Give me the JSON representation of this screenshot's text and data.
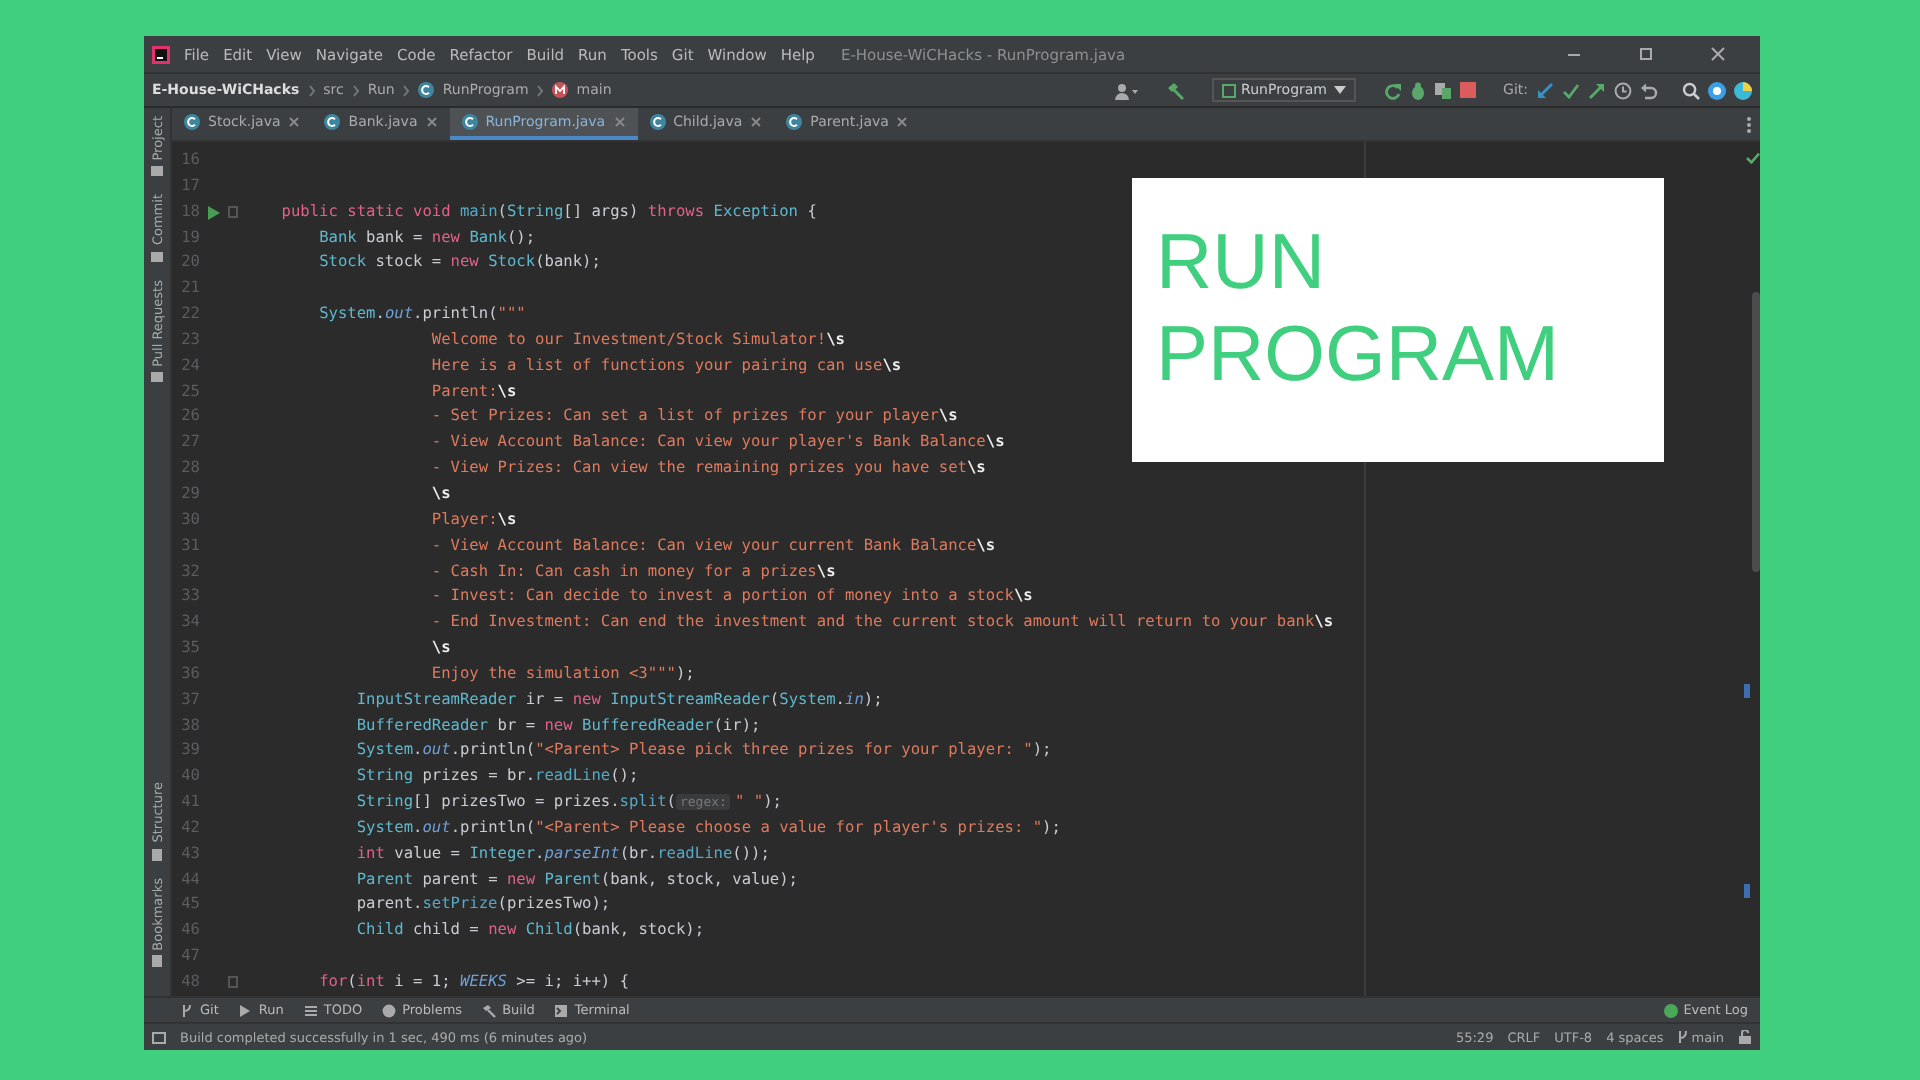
{
  "window": {
    "title": "E-House-WiCHacks - RunProgram.java",
    "menu": [
      "File",
      "Edit",
      "View",
      "Navigate",
      "Code",
      "Refactor",
      "Build",
      "Run",
      "Tools",
      "Git",
      "Window",
      "Help"
    ]
  },
  "breadcrumb": [
    {
      "label": "E-House-WiCHacks",
      "kind": "project"
    },
    {
      "label": "src",
      "kind": "folder"
    },
    {
      "label": "Run",
      "kind": "folder"
    },
    {
      "label": "RunProgram",
      "kind": "class"
    },
    {
      "label": "main",
      "kind": "method"
    }
  ],
  "toolbar": {
    "run_configuration": "RunProgram",
    "vcs_label": "Git:"
  },
  "side_tools": [
    {
      "label": "Project",
      "kind": "top"
    },
    {
      "label": "Commit",
      "kind": "top"
    },
    {
      "label": "Pull Requests",
      "kind": "top"
    },
    {
      "label": "Structure",
      "kind": "bottom"
    },
    {
      "label": "Bookmarks",
      "kind": "bottom"
    }
  ],
  "tabs": [
    {
      "label": "Stock.java",
      "selected": false
    },
    {
      "label": "Bank.java",
      "selected": false
    },
    {
      "label": "RunProgram.java",
      "selected": true
    },
    {
      "label": "Child.java",
      "selected": false
    },
    {
      "label": "Parent.java",
      "selected": false
    }
  ],
  "editor": {
    "lines": [
      {
        "n": "16",
        "run": false,
        "fold": false
      },
      {
        "n": "17",
        "run": false,
        "fold": false
      },
      {
        "n": "18",
        "run": true,
        "fold": true,
        "kind": "member",
        "tokens": [
          {
            "kind": "kw",
            "text": "public static void "
          },
          {
            "kind": "fn",
            "text": "main"
          },
          {
            "kind": "plain",
            "text": "("
          },
          {
            "kind": "type",
            "text": "String"
          },
          {
            "kind": "plain",
            "text": "[] args) "
          },
          {
            "kind": "kw",
            "text": "throws "
          },
          {
            "kind": "type",
            "text": "Exception"
          },
          {
            "kind": "plain",
            "text": " {"
          }
        ]
      },
      {
        "n": "19",
        "run": false,
        "fold": false,
        "kind": "method",
        "tokens": [
          {
            "kind": "type",
            "text": "Bank"
          },
          {
            "kind": "plain",
            "text": " bank = "
          },
          {
            "kind": "kw",
            "text": "new "
          },
          {
            "kind": "type",
            "text": "Bank"
          },
          {
            "kind": "plain",
            "text": "();"
          }
        ]
      },
      {
        "n": "20",
        "run": false,
        "fold": false,
        "kind": "method",
        "tokens": [
          {
            "kind": "type",
            "text": "Stock"
          },
          {
            "kind": "plain",
            "text": " stock = "
          },
          {
            "kind": "kw",
            "text": "new "
          },
          {
            "kind": "type",
            "text": "Stock"
          },
          {
            "kind": "plain",
            "text": "(bank);"
          }
        ]
      },
      {
        "n": "21",
        "run": false,
        "fold": false
      },
      {
        "n": "22",
        "run": false,
        "fold": false,
        "kind": "method",
        "tokens": [
          {
            "kind": "type",
            "text": "System"
          },
          {
            "kind": "plain",
            "text": "."
          },
          {
            "kind": "field",
            "text": "out"
          },
          {
            "kind": "plain",
            "text": ".println("
          },
          {
            "kind": "str",
            "text": "\"\"\""
          }
        ]
      },
      {
        "n": "23",
        "run": false,
        "fold": false,
        "kind": "text",
        "tokens": [
          {
            "kind": "str",
            "text": "Welcome to our Investment/Stock Simulator!"
          },
          {
            "kind": "esc",
            "text": "\\s"
          }
        ]
      },
      {
        "n": "24",
        "run": false,
        "fold": false,
        "kind": "text",
        "tokens": [
          {
            "kind": "str",
            "text": "Here is a list of functions your pairing can use"
          },
          {
            "kind": "esc",
            "text": "\\s"
          }
        ]
      },
      {
        "n": "25",
        "run": false,
        "fold": false,
        "kind": "text",
        "tokens": [
          {
            "kind": "str",
            "text": "Parent:"
          },
          {
            "kind": "esc",
            "text": "\\s"
          }
        ]
      },
      {
        "n": "26",
        "run": false,
        "fold": false,
        "kind": "text",
        "tokens": [
          {
            "kind": "str",
            "text": "- Set Prizes: Can set a list of prizes for your player"
          },
          {
            "kind": "esc",
            "text": "\\s"
          }
        ]
      },
      {
        "n": "27",
        "run": false,
        "fold": false,
        "kind": "text",
        "tokens": [
          {
            "kind": "str",
            "text": "- View Account Balance: Can view your player's Bank Balance"
          },
          {
            "kind": "esc",
            "text": "\\s"
          }
        ]
      },
      {
        "n": "28",
        "run": false,
        "fold": false,
        "kind": "text",
        "tokens": [
          {
            "kind": "str",
            "text": "- View Prizes: Can view the remaining prizes you have set"
          },
          {
            "kind": "esc",
            "text": "\\s"
          }
        ]
      },
      {
        "n": "29",
        "run": false,
        "fold": false,
        "kind": "text",
        "tokens": [
          {
            "kind": "esc",
            "text": "\\s"
          }
        ]
      },
      {
        "n": "30",
        "run": false,
        "fold": false,
        "kind": "text",
        "tokens": [
          {
            "kind": "str",
            "text": "Player:"
          },
          {
            "kind": "esc",
            "text": "\\s"
          }
        ]
      },
      {
        "n": "31",
        "run": false,
        "fold": false,
        "kind": "text",
        "tokens": [
          {
            "kind": "str",
            "text": "- View Account Balance: Can view your current Bank Balance"
          },
          {
            "kind": "esc",
            "text": "\\s"
          }
        ]
      },
      {
        "n": "32",
        "run": false,
        "fold": false,
        "kind": "text",
        "tokens": [
          {
            "kind": "str",
            "text": "- Cash In: Can cash in money for a prizes"
          },
          {
            "kind": "esc",
            "text": "\\s"
          }
        ]
      },
      {
        "n": "33",
        "run": false,
        "fold": false,
        "kind": "text",
        "tokens": [
          {
            "kind": "str",
            "text": "- Invest: Can decide to invest a portion of money into a stock"
          },
          {
            "kind": "esc",
            "text": "\\s"
          }
        ]
      },
      {
        "n": "34",
        "run": false,
        "fold": false,
        "kind": "text",
        "tokens": [
          {
            "kind": "str",
            "text": "- End Investment: Can end the investment and the current stock amount will return to your bank"
          },
          {
            "kind": "esc",
            "text": "\\s"
          }
        ]
      },
      {
        "n": "35",
        "run": false,
        "fold": false,
        "kind": "text",
        "tokens": [
          {
            "kind": "esc",
            "text": "\\s"
          }
        ]
      },
      {
        "n": "36",
        "run": false,
        "fold": false,
        "kind": "text",
        "tokens": [
          {
            "kind": "str",
            "text": "Enjoy the simulation <3\"\"\""
          },
          {
            "kind": "plain",
            "text": ");"
          }
        ]
      },
      {
        "n": "37",
        "run": false,
        "fold": false,
        "kind": "nested",
        "tokens": [
          {
            "kind": "type",
            "text": "InputStreamReader"
          },
          {
            "kind": "plain",
            "text": " ir = "
          },
          {
            "kind": "kw",
            "text": "new "
          },
          {
            "kind": "type",
            "text": "InputStreamReader"
          },
          {
            "kind": "plain",
            "text": "("
          },
          {
            "kind": "type",
            "text": "System"
          },
          {
            "kind": "plain",
            "text": "."
          },
          {
            "kind": "field",
            "text": "in"
          },
          {
            "kind": "plain",
            "text": ");"
          }
        ]
      },
      {
        "n": "38",
        "run": false,
        "fold": false,
        "kind": "nested",
        "tokens": [
          {
            "kind": "type",
            "text": "BufferedReader"
          },
          {
            "kind": "plain",
            "text": " br = "
          },
          {
            "kind": "kw",
            "text": "new "
          },
          {
            "kind": "type",
            "text": "BufferedReader"
          },
          {
            "kind": "plain",
            "text": "(ir);"
          }
        ]
      },
      {
        "n": "39",
        "run": false,
        "fold": false,
        "kind": "nested",
        "tokens": [
          {
            "kind": "type",
            "text": "System"
          },
          {
            "kind": "plain",
            "text": "."
          },
          {
            "kind": "field",
            "text": "out"
          },
          {
            "kind": "plain",
            "text": ".println("
          },
          {
            "kind": "str",
            "text": "\"<Parent> Please pick three prizes for your player: \""
          },
          {
            "kind": "plain",
            "text": ");"
          }
        ]
      },
      {
        "n": "40",
        "run": false,
        "fold": false,
        "kind": "nested",
        "tokens": [
          {
            "kind": "type",
            "text": "String"
          },
          {
            "kind": "plain",
            "text": " prizes = br."
          },
          {
            "kind": "fn",
            "text": "readLine"
          },
          {
            "kind": "plain",
            "text": "();"
          }
        ]
      },
      {
        "n": "41",
        "run": false,
        "fold": false,
        "kind": "nested",
        "tokens": [
          {
            "kind": "type",
            "text": "String"
          },
          {
            "kind": "plain",
            "text": "[] prizesTwo = prizes."
          },
          {
            "kind": "fn",
            "text": "split"
          },
          {
            "kind": "plain",
            "text": "("
          },
          {
            "kind": "hint",
            "text": "regex:"
          },
          {
            "kind": "str",
            "text": "\" \""
          },
          {
            "kind": "plain",
            "text": ");"
          }
        ]
      },
      {
        "n": "42",
        "run": false,
        "fold": false,
        "kind": "nested",
        "tokens": [
          {
            "kind": "type",
            "text": "System"
          },
          {
            "kind": "plain",
            "text": "."
          },
          {
            "kind": "field",
            "text": "out"
          },
          {
            "kind": "plain",
            "text": ".println("
          },
          {
            "kind": "str",
            "text": "\"<Parent> Please choose a value for player's prizes: \""
          },
          {
            "kind": "plain",
            "text": ");"
          }
        ]
      },
      {
        "n": "43",
        "run": false,
        "fold": false,
        "kind": "nested",
        "tokens": [
          {
            "kind": "kw",
            "text": "int "
          },
          {
            "kind": "plain",
            "text": "value = "
          },
          {
            "kind": "type",
            "text": "Integer"
          },
          {
            "kind": "plain",
            "text": "."
          },
          {
            "kind": "static",
            "text": "parseInt"
          },
          {
            "kind": "plain",
            "text": "(br."
          },
          {
            "kind": "fn",
            "text": "readLine"
          },
          {
            "kind": "plain",
            "text": "());"
          }
        ]
      },
      {
        "n": "44",
        "run": false,
        "fold": false,
        "kind": "nested",
        "tokens": [
          {
            "kind": "type",
            "text": "Parent"
          },
          {
            "kind": "plain",
            "text": " parent = "
          },
          {
            "kind": "kw",
            "text": "new "
          },
          {
            "kind": "type",
            "text": "Parent"
          },
          {
            "kind": "plain",
            "text": "(bank, stock, value);"
          }
        ]
      },
      {
        "n": "45",
        "run": false,
        "fold": false,
        "kind": "nested",
        "tokens": [
          {
            "kind": "plain",
            "text": "parent."
          },
          {
            "kind": "fn",
            "text": "setPrize"
          },
          {
            "kind": "plain",
            "text": "(prizesTwo);"
          }
        ]
      },
      {
        "n": "46",
        "run": false,
        "fold": false,
        "kind": "nested",
        "tokens": [
          {
            "kind": "type",
            "text": "Child"
          },
          {
            "kind": "plain",
            "text": " child = "
          },
          {
            "kind": "kw",
            "text": "new "
          },
          {
            "kind": "type",
            "text": "Child"
          },
          {
            "kind": "plain",
            "text": "(bank, stock);"
          }
        ]
      },
      {
        "n": "47",
        "run": false,
        "fold": false
      },
      {
        "n": "48",
        "run": false,
        "fold": true,
        "kind": "method",
        "tokens": [
          {
            "kind": "kw",
            "text": "for"
          },
          {
            "kind": "plain",
            "text": "("
          },
          {
            "kind": "kw",
            "text": "int "
          },
          {
            "kind": "plain",
            "text": "i = 1; "
          },
          {
            "kind": "static",
            "text": "WEEKS"
          },
          {
            "kind": "plain",
            "text": " >= i; i++) {"
          }
        ]
      }
    ]
  },
  "tool_windows": [
    {
      "label": "Git",
      "kind": "git"
    },
    {
      "label": "Run",
      "kind": "run"
    },
    {
      "label": "TODO",
      "kind": "todo"
    },
    {
      "label": "Problems",
      "kind": "problems"
    },
    {
      "label": "Build",
      "kind": "build"
    },
    {
      "label": "Terminal",
      "kind": "terminal"
    }
  ],
  "event_log": "Event Log",
  "status": {
    "message": "Build completed successfully in 1 sec, 490 ms (6 minutes ago)",
    "items": [
      "55:29",
      "CRLF",
      "UTF-8",
      "4 spaces"
    ],
    "branch": "main"
  },
  "overlay": {
    "heading": "RUN PROGRAM"
  }
}
